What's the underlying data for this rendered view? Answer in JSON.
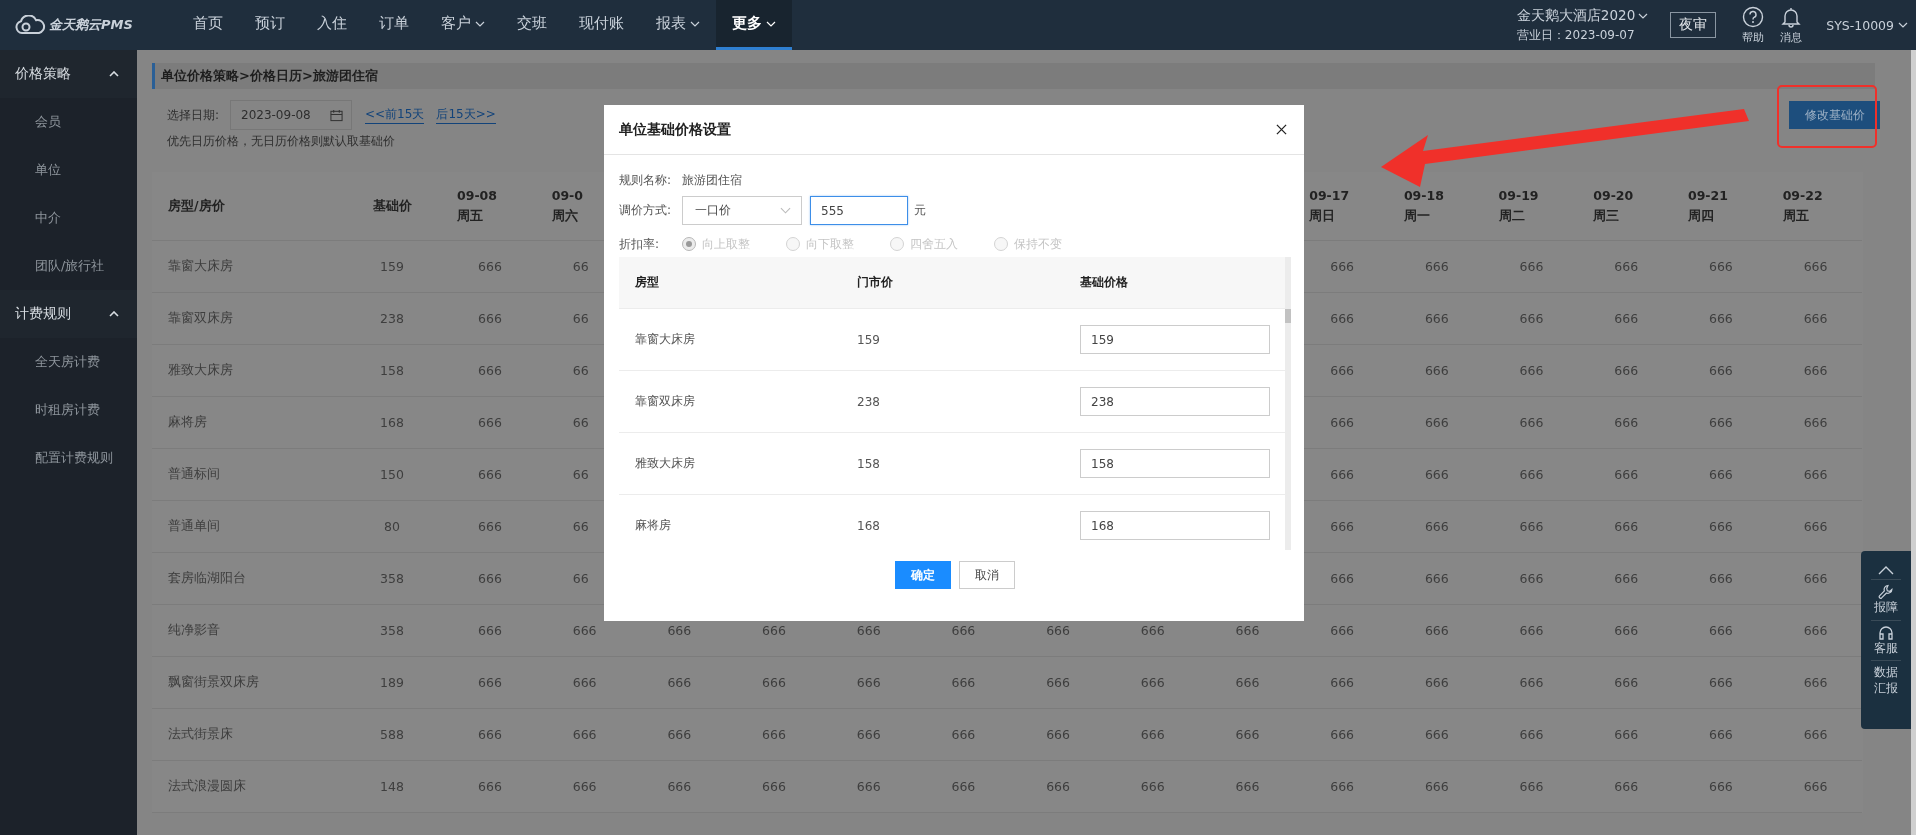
{
  "app": {
    "logo": "金天鹅云PMS"
  },
  "nav": [
    {
      "label": "首页",
      "dropdown": false,
      "selected": false
    },
    {
      "label": "预订",
      "dropdown": false,
      "selected": false
    },
    {
      "label": "入住",
      "dropdown": false,
      "selected": false
    },
    {
      "label": "订单",
      "dropdown": false,
      "selected": false
    },
    {
      "label": "客户",
      "dropdown": true,
      "selected": false
    },
    {
      "label": "交班",
      "dropdown": false,
      "selected": false
    },
    {
      "label": "现付账",
      "dropdown": false,
      "selected": false
    },
    {
      "label": "报表",
      "dropdown": true,
      "selected": false
    },
    {
      "label": "更多",
      "dropdown": true,
      "selected": true
    }
  ],
  "hotel": {
    "name": "金天鹅大酒店2020",
    "business_day": "营业日：2023-09-07"
  },
  "night_audit": "夜审",
  "header_actions": [
    {
      "kind": "help",
      "label": "帮助"
    },
    {
      "kind": "bell",
      "label": "消息"
    }
  ],
  "user": "SYS-10009",
  "sidebar": [
    {
      "label": "价格策略",
      "expanded": true,
      "children": [
        {
          "label": "会员",
          "selected": false
        },
        {
          "label": "单位",
          "selected": false
        },
        {
          "label": "中介",
          "selected": false
        },
        {
          "label": "团队/旅行社",
          "selected": false
        }
      ]
    },
    {
      "label": "计费规则",
      "expanded": true,
      "children": [
        {
          "label": "全天房计费",
          "selected": false
        },
        {
          "label": "时租房计费",
          "selected": false
        },
        {
          "label": "配置计费规则",
          "selected": false
        }
      ]
    }
  ],
  "breadcrumb": "单位价格策略>价格日历>旅游团住宿",
  "date_picker": {
    "label": "选择日期:",
    "value": "2023-09-08"
  },
  "prev_link": "<<前15天",
  "next_link": "后15天>>",
  "note": "优先日历价格，无日历价格则默认取基础价",
  "edit_button": "修改基础价",
  "calendar": {
    "room_header": "房型/房价",
    "base_header": "基础价",
    "columns": [
      {
        "date": "09-08",
        "weekday": "周五"
      },
      {
        "date": "09-0",
        "weekday": "周六"
      },
      {
        "date": "09-17",
        "weekday": "周日"
      },
      {
        "date": "09-18",
        "weekday": "周一"
      },
      {
        "date": "09-19",
        "weekday": "周二"
      },
      {
        "date": "09-20",
        "weekday": "周三"
      },
      {
        "date": "09-21",
        "weekday": "周四"
      },
      {
        "date": "09-22",
        "weekday": "周五"
      }
    ],
    "rows": [
      {
        "room": "靠窗大床房",
        "base": "159",
        "prices": [
          "666",
          "66",
          "666",
          "666",
          "666",
          "666",
          "666",
          "666"
        ]
      },
      {
        "room": "靠窗双床房",
        "base": "238",
        "prices": [
          "666",
          "66",
          "666",
          "666",
          "666",
          "666",
          "666",
          "666"
        ]
      },
      {
        "room": "雅致大床房",
        "base": "158",
        "prices": [
          "666",
          "66",
          "666",
          "666",
          "666",
          "666",
          "666",
          "666"
        ]
      },
      {
        "room": "麻将房",
        "base": "168",
        "prices": [
          "666",
          "66",
          "666",
          "666",
          "666",
          "666",
          "666",
          "666"
        ]
      },
      {
        "room": "普通标间",
        "base": "150",
        "prices": [
          "666",
          "66",
          "666",
          "666",
          "666",
          "666",
          "666",
          "666"
        ]
      },
      {
        "room": "普通单间",
        "base": "80",
        "prices": [
          "666",
          "66",
          "666",
          "666",
          "666",
          "666",
          "666",
          "666"
        ]
      },
      {
        "room": "套房临湖阳台",
        "base": "358",
        "prices": [
          "666",
          "66",
          "666",
          "666",
          "666",
          "666",
          "666",
          "666"
        ]
      },
      {
        "room": "纯净影音",
        "base": "358",
        "prices": [
          "666",
          "666",
          "666",
          "666",
          "666",
          "666",
          "666",
          "666",
          "666",
          "666",
          "666",
          "666",
          "666",
          "666",
          "666"
        ]
      },
      {
        "room": "飘窗街景双床房",
        "base": "189",
        "prices": [
          "666",
          "666",
          "666",
          "666",
          "666",
          "666",
          "666",
          "666",
          "666",
          "666",
          "666",
          "666",
          "666",
          "666",
          "666"
        ]
      },
      {
        "room": "法式街景床",
        "base": "588",
        "prices": [
          "666",
          "666",
          "666",
          "666",
          "666",
          "666",
          "666",
          "666",
          "666",
          "666",
          "666",
          "666",
          "666",
          "666",
          "666"
        ]
      },
      {
        "room": "法式浪漫圆床",
        "base": "148",
        "prices": [
          "666",
          "666",
          "666",
          "666",
          "666",
          "666",
          "666",
          "666",
          "666",
          "666",
          "666",
          "666",
          "666",
          "666",
          "666"
        ]
      }
    ]
  },
  "dialog": {
    "title": "单位基础价格设置",
    "rule_label": "规则名称:",
    "rule_name": "旅游团住宿",
    "method_label": "调价方式:",
    "method": "一口价",
    "amount": "555",
    "unit": "元",
    "rounding_label": "折扣率:",
    "rounding_options": [
      {
        "label": "向上取整",
        "selected": true,
        "disabled": true
      },
      {
        "label": "向下取整",
        "selected": false,
        "disabled": true
      },
      {
        "label": "四舍五入",
        "selected": false,
        "disabled": true
      },
      {
        "label": "保持不变",
        "selected": false,
        "disabled": true
      }
    ],
    "columns": [
      "房型",
      "门市价",
      "基础价格"
    ],
    "rows": [
      {
        "room": "靠窗大床房",
        "rack": "159",
        "base": "159"
      },
      {
        "room": "靠窗双床房",
        "rack": "238",
        "base": "238"
      },
      {
        "room": "雅致大床房",
        "rack": "158",
        "base": "158"
      },
      {
        "room": "麻将房",
        "rack": "168",
        "base": "168"
      }
    ],
    "buttons": [
      {
        "label": "确定",
        "kind": "primary"
      },
      {
        "label": "取消",
        "kind": "default"
      }
    ]
  },
  "side_tools": [
    {
      "kind": "top"
    },
    {
      "kind": "wrench",
      "label": "报障"
    },
    {
      "kind": "headset",
      "label": "客服"
    },
    {
      "kind": "text",
      "label": "数据汇报"
    }
  ]
}
